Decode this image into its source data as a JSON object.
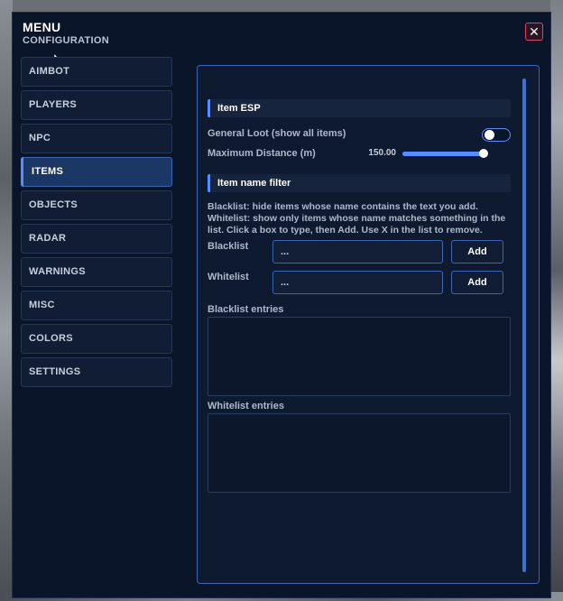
{
  "header": {
    "title": "MENU",
    "subtitle": "CONFIGURATION",
    "close_label": "✕"
  },
  "sidebar": {
    "items": [
      {
        "label": "AIMBOT",
        "active": false
      },
      {
        "label": "PLAYERS",
        "active": false
      },
      {
        "label": "NPC",
        "active": false
      },
      {
        "label": "ITEMS",
        "active": true
      },
      {
        "label": "OBJECTS",
        "active": false
      },
      {
        "label": "RADAR",
        "active": false
      },
      {
        "label": "WARNINGS",
        "active": false
      },
      {
        "label": "MISC",
        "active": false
      },
      {
        "label": "COLORS",
        "active": false
      },
      {
        "label": "SETTINGS",
        "active": false
      }
    ]
  },
  "panel": {
    "item_esp": {
      "heading": "Item ESP",
      "general_loot_label": "General Loot (show all items)",
      "general_loot_enabled": false,
      "max_distance_label": "Maximum Distance (m)",
      "max_distance_value": "150.00",
      "max_distance_fraction": 0.97
    },
    "filter": {
      "heading": "Item name filter",
      "help_text": "Blacklist: hide items whose name contains the text you add. Whitelist: show only items whose name matches something in the list. Click a box to type, then Add. Use X in the list to remove.",
      "blacklist_label": "Blacklist",
      "blacklist_input_value": "...",
      "blacklist_add_label": "Add",
      "whitelist_label": "Whitelist",
      "whitelist_input_value": "...",
      "whitelist_add_label": "Add",
      "blacklist_entries_label": "Blacklist entries",
      "whitelist_entries_label": "Whitelist entries"
    }
  },
  "colors": {
    "accent": "#5b8cff",
    "window_bg": "#0b1529",
    "active_item_bg": "#1b3766",
    "close_border": "#d9475b"
  },
  "icons": {
    "close": "close-icon"
  }
}
